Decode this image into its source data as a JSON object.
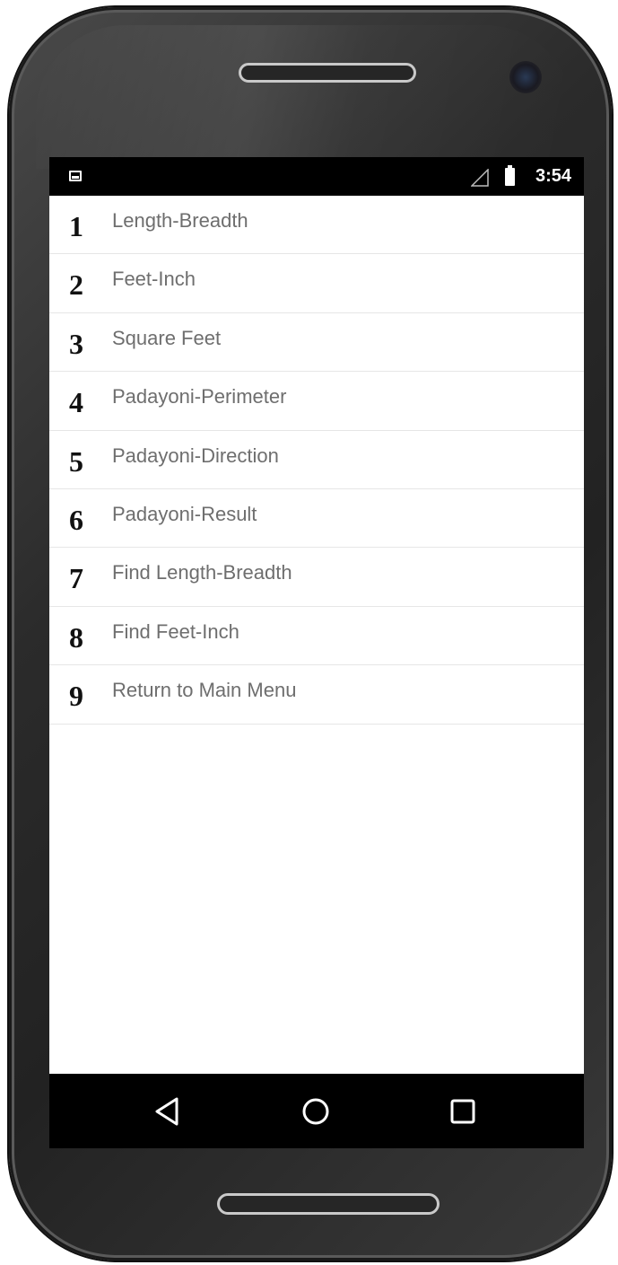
{
  "status_bar": {
    "time": "3:54",
    "icons": [
      "image-notification-icon",
      "signal-icon",
      "battery-icon"
    ]
  },
  "menu": {
    "items": [
      {
        "number": "1",
        "label": "Length-Breadth"
      },
      {
        "number": "2",
        "label": "Feet-Inch"
      },
      {
        "number": "3",
        "label": "Square Feet"
      },
      {
        "number": "4",
        "label": "Padayoni-Perimeter"
      },
      {
        "number": "5",
        "label": "Padayoni-Direction"
      },
      {
        "number": "6",
        "label": "Padayoni-Result"
      },
      {
        "number": "7",
        "label": "Find Length-Breadth"
      },
      {
        "number": "8",
        "label": "Find Feet-Inch"
      },
      {
        "number": "9",
        "label": "Return to Main Menu"
      }
    ]
  },
  "nav_bar": {
    "buttons": [
      "back-icon",
      "home-icon",
      "recent-apps-icon"
    ]
  },
  "colors": {
    "status_bar": "#000000",
    "nav_bar": "#000000",
    "screen_background": "#ffffff",
    "label_text": "#6e6e6e",
    "number_text": "#111111",
    "divider": "#e6e6e6",
    "phone_body": "#2b2b2b"
  }
}
